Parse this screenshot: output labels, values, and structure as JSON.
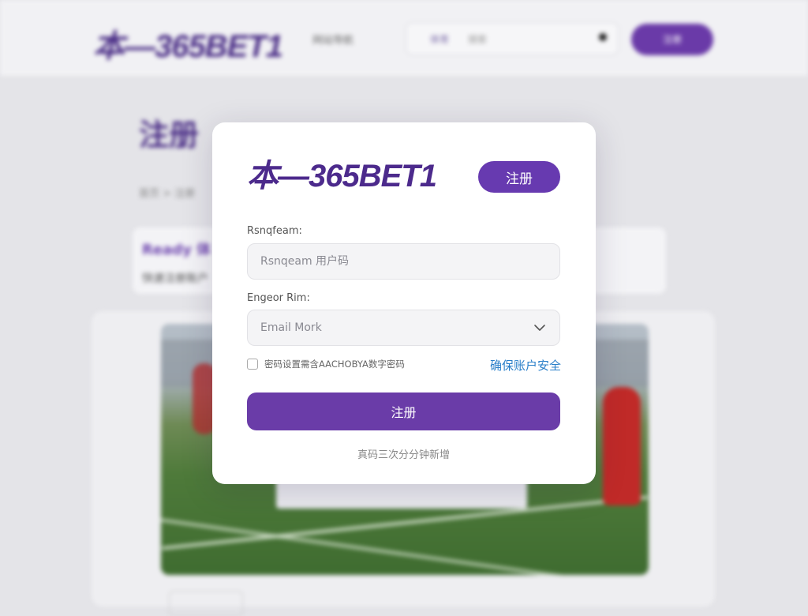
{
  "background": {
    "logo": "本—365BET1",
    "nav_text": "网站导航",
    "search": {
      "prefix": "体育",
      "placeholder": "搜索"
    },
    "header_button": "注册",
    "page_heading": "注册",
    "breadcrumb": "首页 > 注册",
    "card_title": "Ready 体",
    "card_subtitle": "快速注册账户"
  },
  "modal": {
    "logo": "本—365BET1",
    "header_button": "注册",
    "username": {
      "label": "Rsnqfeam:",
      "placeholder": "Rsnqeam 用户码"
    },
    "email": {
      "label": "Engeor Rim:",
      "value": "Email Mork",
      "chevron_icon": "chevron-down-icon"
    },
    "password_hint": "密码设置需含AACHOBYA数字密码",
    "secure_link": "确保账户安全",
    "submit_button": "注册",
    "footer_note": "真码三次分分钟新增"
  },
  "colors": {
    "brand_purple": "#673ab0",
    "logo_purple": "#4c2a8c",
    "link_blue": "#2a7fc9"
  }
}
